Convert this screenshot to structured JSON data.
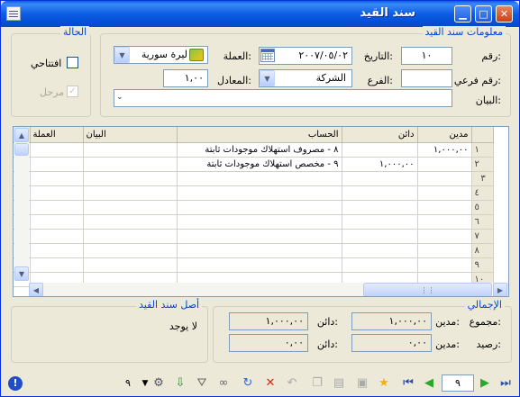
{
  "window": {
    "title": "سند القيد"
  },
  "entry_info": {
    "legend": "معلومات سند القيد",
    "number_label": "رقم:",
    "number_value": "١٠",
    "date_label": "التاريخ:",
    "date_value": "٢٠٠٧/٠٥/٠٢",
    "currency_label": "العملة:",
    "currency_value": "ليرة سورية",
    "sub_number_label": "رقم فرعي:",
    "sub_number_value": "",
    "branch_label": "الفرع:",
    "branch_value": "الشركة",
    "rate_label": "المعادل:",
    "rate_value": "١,٠٠",
    "statement_label": "البيان:",
    "statement_value": ""
  },
  "status_group": {
    "legend": "الحالة",
    "opening_label": "افتتاحي",
    "opening_checked": false,
    "posted_label": "مرحل",
    "posted_checked": true
  },
  "grid": {
    "columns": [
      "مدين",
      "دائن",
      "الحساب",
      "البيان",
      "العملة"
    ],
    "row_numbers": [
      "١",
      "٢",
      "٣",
      "٤",
      "٥",
      "٦",
      "٧",
      "٨",
      "٩",
      "١٠"
    ],
    "rows": [
      {
        "debit": "١,٠٠٠,٠٠",
        "credit": "",
        "account": "٨ - مصروف استهلاك موجودات ثابتة",
        "statement": "",
        "currency": ""
      },
      {
        "debit": "",
        "credit": "١,٠٠٠,٠٠",
        "account": "٩ - مخصص استهلاك موجودات ثابتة",
        "statement": "",
        "currency": ""
      }
    ]
  },
  "totals": {
    "legend": "الإجمالي",
    "sum_label": "مجموع:",
    "balance_label": "رصيد:",
    "debit_label": "مدين:",
    "credit_label": "دائن:",
    "sum_debit": "١,٠٠٠,٠٠",
    "sum_credit": "١,٠٠٠,٠٠",
    "balance_debit": "٠,٠٠",
    "balance_credit": "٠,٠٠"
  },
  "origin": {
    "legend": "أصل سند القيد",
    "value": "لا يوجد"
  },
  "toolbar": {
    "record_number": "٩",
    "filter_count": "٩"
  },
  "colors": {
    "title_bar": "#0a5de3",
    "legend_text": "#0046d5",
    "window_bg": "#ece9d8"
  }
}
